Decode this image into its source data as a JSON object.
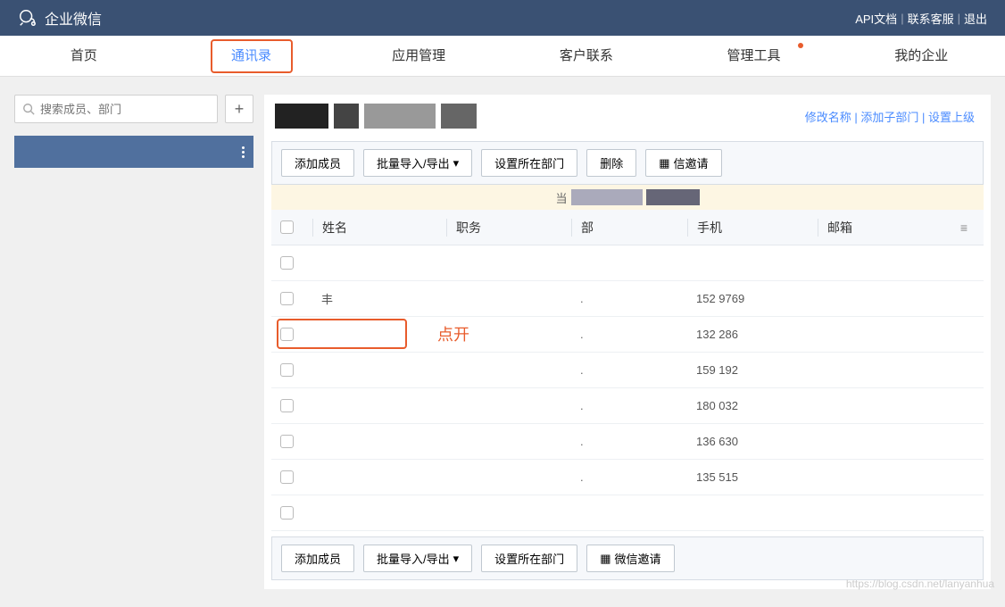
{
  "brand": "企业微信",
  "top_links": {
    "api": "API文档",
    "contact": "联系客服",
    "logout": "退出"
  },
  "nav": [
    "首页",
    "通讯录",
    "应用管理",
    "客户联系",
    "管理工具",
    "我的企业"
  ],
  "nav_active_index": 1,
  "nav_dot_index": 4,
  "search": {
    "placeholder": "搜索成员、部门"
  },
  "header_actions": {
    "rename": "修改名称",
    "add_sub": "添加子部门",
    "set_parent": "设置上级"
  },
  "toolbar": {
    "add_member": "添加成员",
    "batch": "批量导入/导出",
    "set_dept": "设置所在部门",
    "delete": "删除",
    "wechat_invite": "信邀请"
  },
  "toolbar_bottom": {
    "add_member": "添加成员",
    "batch": "批量导入/导出",
    "set_dept": "设置所在部门",
    "wechat_invite": "微信邀请"
  },
  "columns": {
    "name": "姓名",
    "position": "职务",
    "dept": "部",
    "phone": "手机",
    "email": "邮箱"
  },
  "rows": [
    {
      "name": "",
      "dept": "",
      "phone": ""
    },
    {
      "name": "丰",
      "dept": ".",
      "phone": "152      9769"
    },
    {
      "name": "",
      "dept": ".",
      "phone": "132      286",
      "highlight": true
    },
    {
      "name": "",
      "dept": ".",
      "phone": "159      192"
    },
    {
      "name": "",
      "dept": ".",
      "phone": "180      032"
    },
    {
      "name": "",
      "dept": ".",
      "phone": "136      630"
    },
    {
      "name": "",
      "dept": ".",
      "phone": "135      515"
    },
    {
      "name": "",
      "dept": "",
      "phone": ""
    }
  ],
  "annotation": "点开",
  "watermark": "https://blog.csdn.net/lanyanhua"
}
